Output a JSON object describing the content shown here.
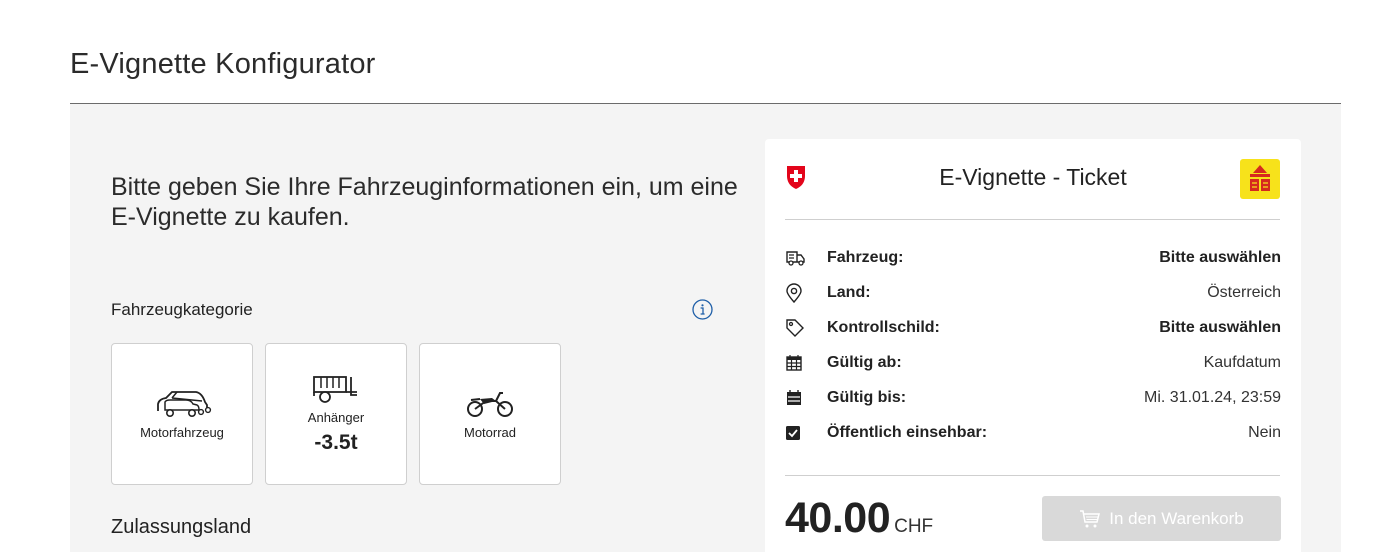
{
  "page": {
    "title": "E-Vignette Konfigurator"
  },
  "form": {
    "intro": "Bitte geben Sie Ihre Fahrzeuginformationen ein, um eine E-Vignette zu kaufen.",
    "category_label": "Fahrzeugkategorie",
    "info_icon": "info-icon",
    "categories": [
      {
        "name": "Motorfahrzeug",
        "sub": "",
        "icon": "car-icon"
      },
      {
        "name": "Anhänger",
        "sub": "-3.5t",
        "icon": "trailer-icon"
      },
      {
        "name": "Motorrad",
        "sub": "",
        "icon": "motorcycle-icon"
      }
    ],
    "country_label": "Zulassungsland"
  },
  "ticket": {
    "title": "E-Vignette - Ticket",
    "logo_icon": "swiss-shield-icon",
    "badge_icon": "vignette-badge-icon",
    "rows": [
      {
        "icon": "vehicle-icon",
        "label": "Fahrzeug:",
        "value": "Bitte auswählen",
        "strong": true
      },
      {
        "icon": "location-icon",
        "label": "Land:",
        "value": "Österreich",
        "strong": false
      },
      {
        "icon": "tag-icon",
        "label": "Kontrollschild:",
        "value": "Bitte auswählen",
        "strong": true
      },
      {
        "icon": "calendar-start-icon",
        "label": "Gültig ab:",
        "value": "Kaufdatum",
        "strong": false
      },
      {
        "icon": "calendar-end-icon",
        "label": "Gültig bis:",
        "value": "Mi. 31.01.24, 23:59",
        "strong": false
      },
      {
        "icon": "checkbox-icon",
        "label": "Öffentlich einsehbar:",
        "value": "Nein",
        "strong": false
      }
    ],
    "price": "40.00",
    "currency": "CHF",
    "cart_label": "In den Warenkorb"
  },
  "colors": {
    "panel_bg": "#f4f4f4",
    "swiss_red": "#e3051b",
    "badge_yellow": "#f7e21b",
    "button_disabled": "#d9d9d9",
    "info_blue": "#1f5fa8"
  }
}
